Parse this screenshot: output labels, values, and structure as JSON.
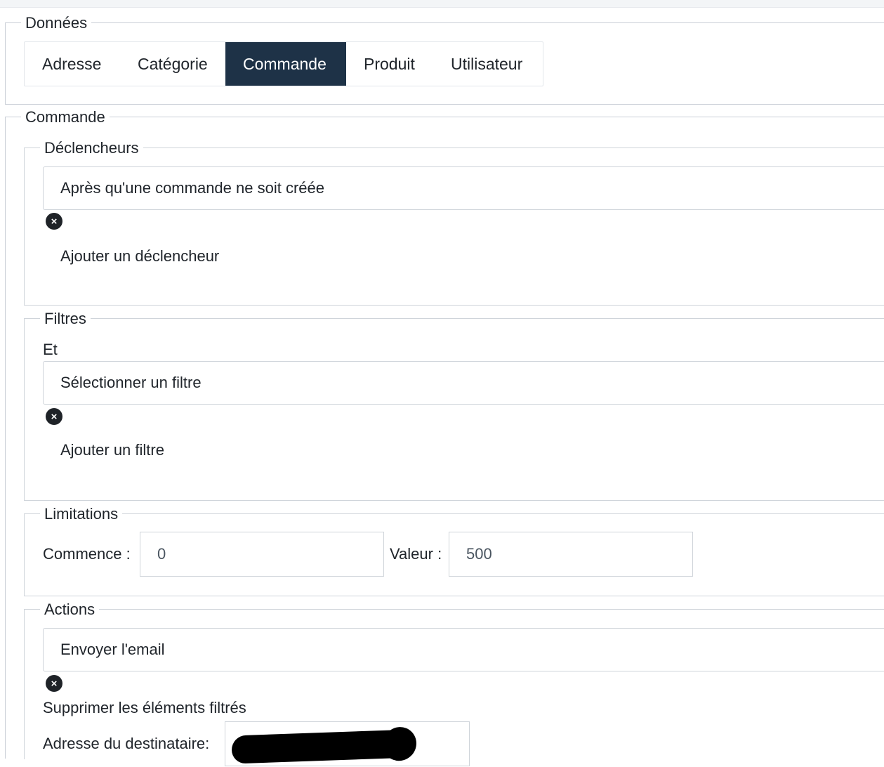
{
  "donnees": {
    "legend": "Données",
    "tabs": [
      {
        "label": "Adresse",
        "active": false
      },
      {
        "label": "Catégorie",
        "active": false
      },
      {
        "label": "Commande",
        "active": true
      },
      {
        "label": "Produit",
        "active": false
      },
      {
        "label": "Utilisateur",
        "active": false
      }
    ]
  },
  "commande": {
    "legend": "Commande",
    "declencheurs": {
      "legend": "Déclencheurs",
      "selected": "Après qu'une commande ne soit créée",
      "add_label": "Ajouter un déclencheur"
    },
    "filtres": {
      "legend": "Filtres",
      "condition": "Et",
      "selected": "Sélectionner un filtre",
      "add_label": "Ajouter un filtre"
    },
    "limitations": {
      "legend": "Limitations",
      "start_label": "Commence :",
      "start_value": "0",
      "value_label": "Valeur :",
      "value_value": "500"
    },
    "actions": {
      "legend": "Actions",
      "selected": "Envoyer l'email",
      "delete_filtered_label": "Supprimer les éléments filtrés",
      "recipient_label": "Adresse du destinataire:"
    }
  },
  "icons": {
    "remove": "close-circle-icon"
  },
  "colors": {
    "active_tab": "#1e3247",
    "border": "#c9ced6",
    "icon": "#1f2328"
  }
}
